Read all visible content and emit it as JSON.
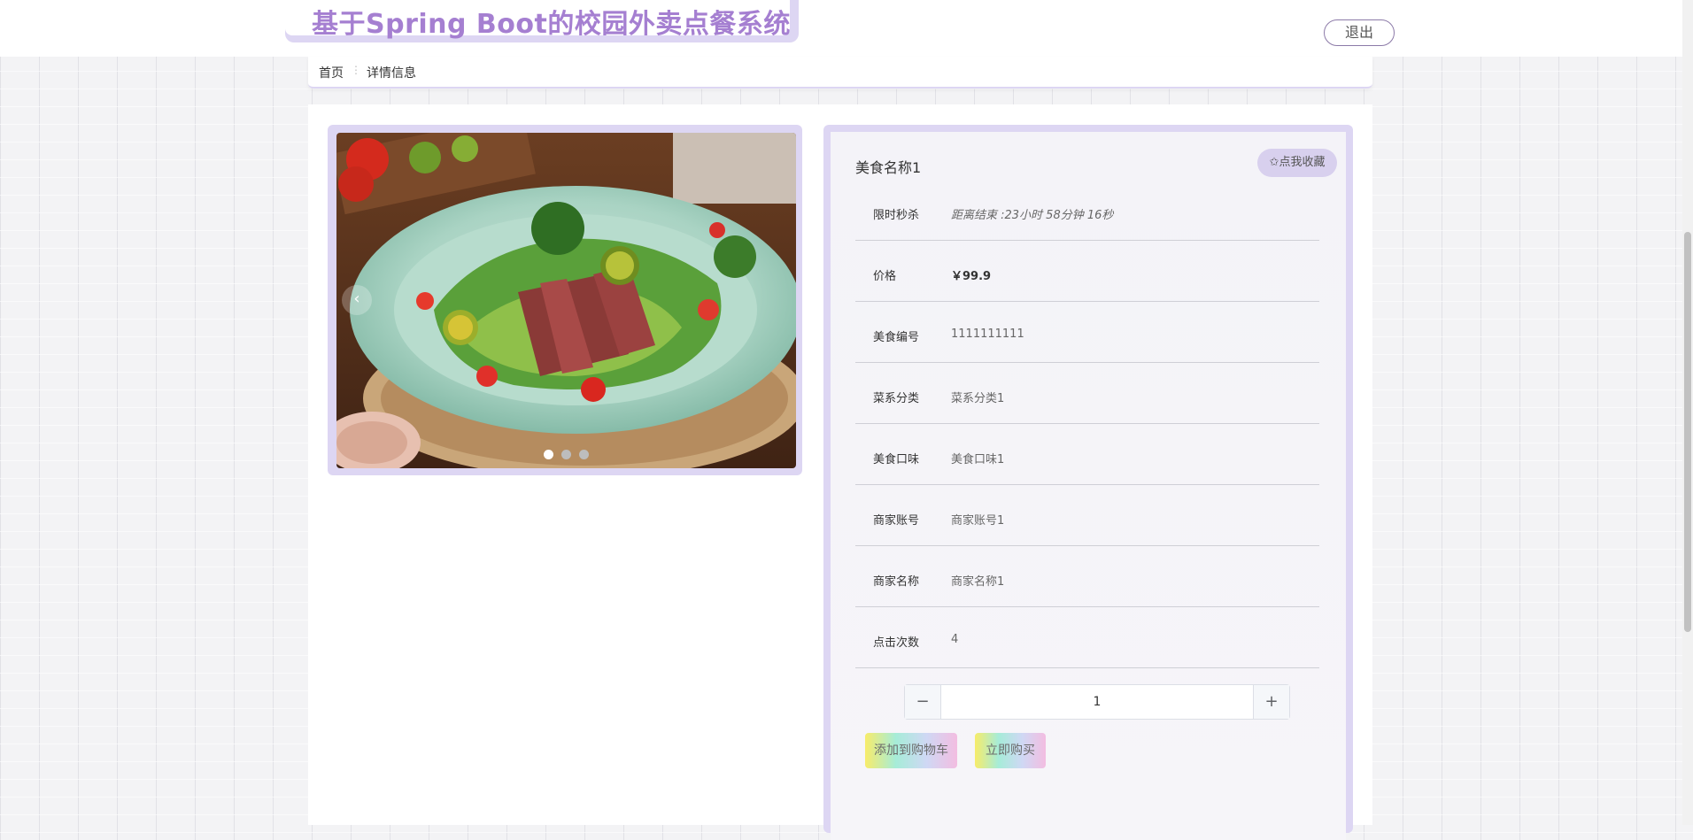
{
  "header": {
    "site_title": "基于Spring Boot的校园外卖点餐系统",
    "logout_label": "退出"
  },
  "breadcrumb": {
    "home": "首页",
    "separator": "⋮",
    "current": "详情信息"
  },
  "carousel": {
    "prev_icon": "chevron-left-icon",
    "slide_count": 3,
    "active_index": 0
  },
  "detail": {
    "name": "美食名称1",
    "favorite_label": "✩点我收藏",
    "rows": [
      {
        "label": "限时秒杀",
        "value": "距离结束 :23小时 58分钟 16秒"
      },
      {
        "label": "价格",
        "value": "￥99.9"
      },
      {
        "label": "美食编号",
        "value": "1111111111"
      },
      {
        "label": "菜系分类",
        "value": "菜系分类1"
      },
      {
        "label": "美食口味",
        "value": "美食口味1"
      },
      {
        "label": "商家账号",
        "value": "商家账号1"
      },
      {
        "label": "商家名称",
        "value": "商家名称1"
      },
      {
        "label": "点击次数",
        "value": "4"
      }
    ],
    "quantity": {
      "minus": "−",
      "value": "1",
      "plus": "+"
    },
    "add_to_cart_label": "添加到购物车",
    "buy_now_label": "立即购买"
  },
  "colors": {
    "accent": "#a57fd1",
    "frame": "#ddd6f3"
  }
}
